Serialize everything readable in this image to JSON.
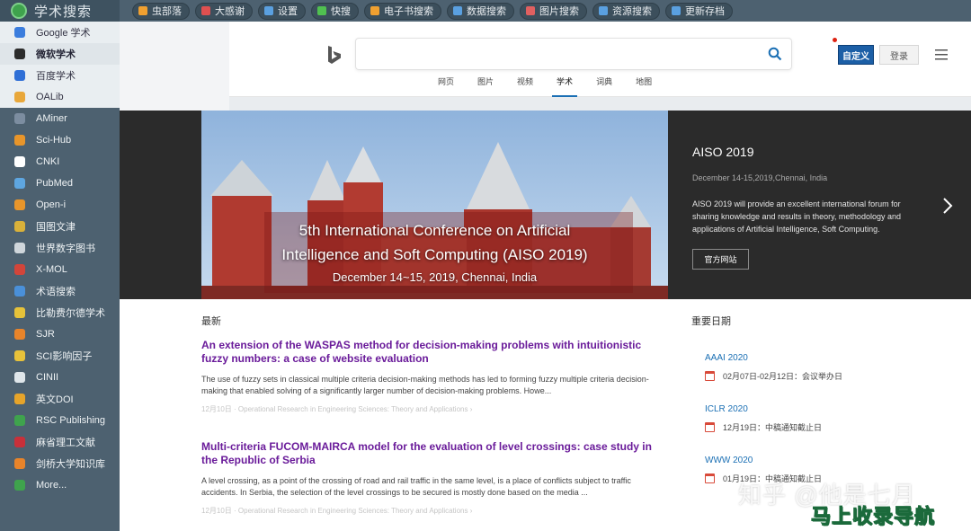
{
  "sidebar": {
    "brand": "学术搜索",
    "items": [
      {
        "label": "Google 学术",
        "icon": "google-icon",
        "color": "#3b7ddd",
        "state": "lite"
      },
      {
        "label": "微软学术",
        "icon": "bing-icon",
        "color": "#2c2c2c",
        "state": "active"
      },
      {
        "label": "百度学术",
        "icon": "baidu-icon",
        "color": "#2f6fd6",
        "state": "lite"
      },
      {
        "label": "OALib",
        "icon": "oalib-icon",
        "color": "#e8a73a",
        "state": "lite"
      },
      {
        "label": "AMiner",
        "icon": "aminer-icon",
        "color": "#7c8da0",
        "state": ""
      },
      {
        "label": "Sci-Hub",
        "icon": "scihub-icon",
        "color": "#e8952a",
        "state": ""
      },
      {
        "label": "CNKI",
        "icon": "cnki-icon",
        "color": "#ffffff",
        "state": ""
      },
      {
        "label": "PubMed",
        "icon": "pubmed-icon",
        "color": "#5ea6e0",
        "state": ""
      },
      {
        "label": "Open-i",
        "icon": "openi-icon",
        "color": "#e8952a",
        "state": ""
      },
      {
        "label": "国图文津",
        "icon": "nlc-icon",
        "color": "#d9b13a",
        "state": ""
      },
      {
        "label": "世界数字图书",
        "icon": "wdl-icon",
        "color": "#cfd6db",
        "state": ""
      },
      {
        "label": "X-MOL",
        "icon": "xmol-icon",
        "color": "#d2453a",
        "state": ""
      },
      {
        "label": "术语搜索",
        "icon": "term-icon",
        "color": "#4a90d9",
        "state": ""
      },
      {
        "label": "比勒费尔德学术",
        "icon": "base-icon",
        "color": "#e6c23a",
        "state": ""
      },
      {
        "label": "SJR",
        "icon": "sjr-icon",
        "color": "#e8842a",
        "state": ""
      },
      {
        "label": "SCI影响因子",
        "icon": "sci-icon",
        "color": "#e8c23a",
        "state": ""
      },
      {
        "label": "CINII",
        "icon": "cinii-icon",
        "color": "#dfe6ea",
        "state": ""
      },
      {
        "label": "英文DOI",
        "icon": "doi-icon",
        "color": "#e6a42a",
        "state": ""
      },
      {
        "label": "RSC Publishing",
        "icon": "rsc-icon",
        "color": "#3fa34d",
        "state": ""
      },
      {
        "label": "麻省理工文献",
        "icon": "mit-icon",
        "color": "#c8303a",
        "state": ""
      },
      {
        "label": "剑桥大学知识库",
        "icon": "cambridge-icon",
        "color": "#e8842a",
        "state": ""
      },
      {
        "label": "More...",
        "icon": "more-icon",
        "color": "#3fa34d",
        "state": ""
      }
    ]
  },
  "toolbar": {
    "items": [
      {
        "label": "虫部落",
        "icon": "bug-icon",
        "color": "#f0a030"
      },
      {
        "label": "大感谢",
        "icon": "heart-icon",
        "color": "#e05050"
      },
      {
        "label": "设置",
        "icon": "gear-icon",
        "color": "#5aa0e0"
      },
      {
        "label": "快搜",
        "icon": "bolt-icon",
        "color": "#50c050"
      },
      {
        "label": "电子书搜索",
        "icon": "book-icon",
        "color": "#f0a030"
      },
      {
        "label": "数据搜索",
        "icon": "data-icon",
        "color": "#5aa0e0"
      },
      {
        "label": "图片搜索",
        "icon": "image-icon",
        "color": "#e06060"
      },
      {
        "label": "资源搜索",
        "icon": "cloud-icon",
        "color": "#5aa0e0"
      },
      {
        "label": "更新存档",
        "icon": "refresh-icon",
        "color": "#5aa0e0"
      }
    ]
  },
  "bing": {
    "search_placeholder": "",
    "custom_label": "自定义",
    "login_label": "登录",
    "tabs": [
      "网页",
      "图片",
      "视频",
      "学术",
      "词典",
      "地图"
    ],
    "active_tab": "学术"
  },
  "hero": {
    "title": "AISO 2019",
    "date": "December 14-15,2019,Chennai, India",
    "description": "AISO 2019 will provide an excellent international forum for sharing knowledge and results in theory, methodology and applications of Artificial Intelligence, Soft Computing.",
    "site_button": "官方网站",
    "overlay_line1": "5th International Conference on Artificial",
    "overlay_line2": "Intelligence and Soft Computing (AISO 2019)",
    "overlay_line3": "December 14~15, 2019, Chennai, India"
  },
  "latest": {
    "heading": "最新",
    "articles": [
      {
        "title": "An extension of the WASPAS method for decision-making problems with intuitionistic fuzzy numbers: a case of website evaluation",
        "snippet": "The use of fuzzy sets in classical multiple criteria decision-making methods has led to forming fuzzy multiple criteria decision-making that enabled solving of a significantly larger number of decision-making problems. Howe...",
        "meta": "12月10日 · Operational Research in Engineering Sciences: Theory and Applications ›"
      },
      {
        "title": "Multi-criteria FUCOM-MAIRCA model for the evaluation of level crossings: case study in the Republic of Serbia",
        "snippet": "A level crossing, as a point of the crossing of road and rail traffic in the same level, is a place of conflicts subject to traffic accidents. In Serbia, the selection of the level crossings to be secured is mostly done based on the media ...",
        "meta": "12月10日 · Operational Research in Engineering Sciences: Theory and Applications ›"
      }
    ]
  },
  "dates": {
    "heading": "重要日期",
    "conferences": [
      {
        "name": "AAAI 2020",
        "detail": "02月07日-02月12日：会议举办日"
      },
      {
        "name": "ICLR 2020",
        "detail": "12月19日：中稿通知截止日"
      },
      {
        "name": "WWW 2020",
        "detail": "01月19日：中稿通知截止日"
      }
    ]
  },
  "watermark": {
    "line1": "知乎 @他是七月",
    "line2": "马上收录导航"
  }
}
